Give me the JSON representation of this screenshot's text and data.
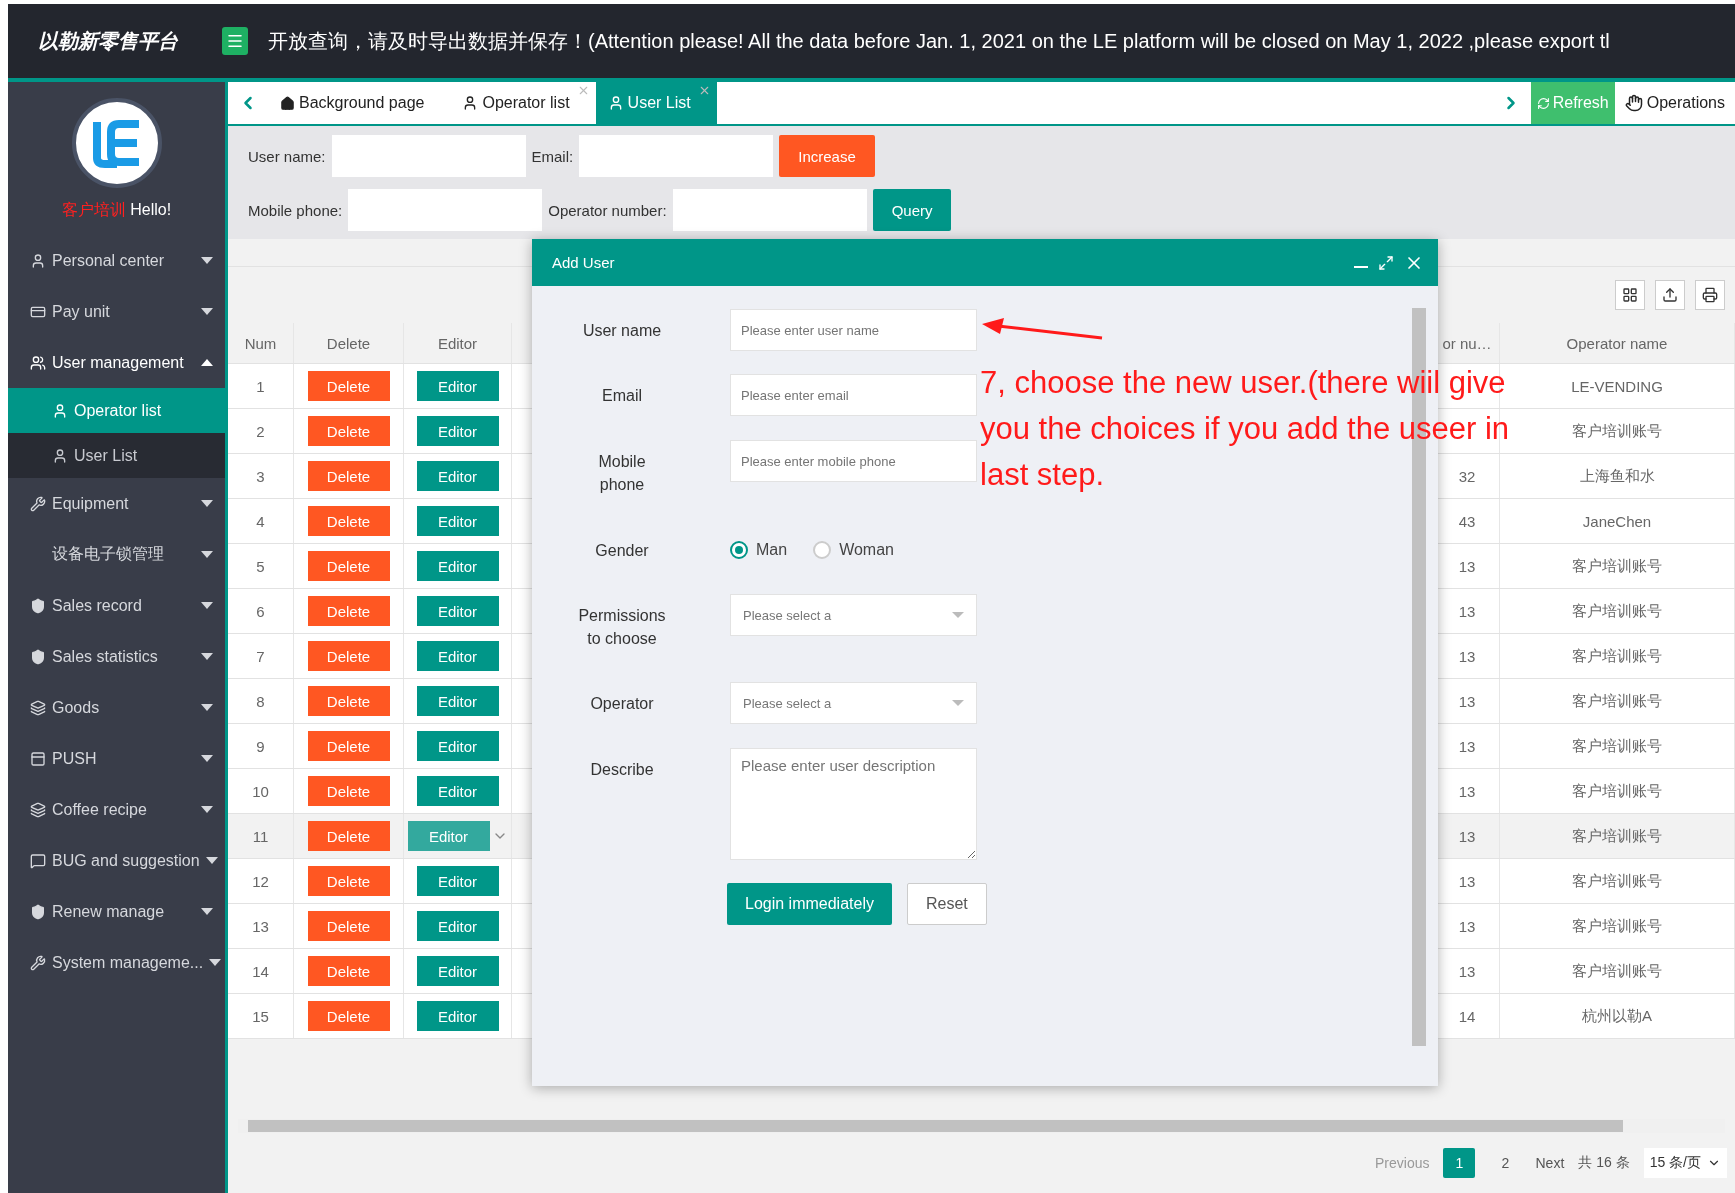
{
  "header": {
    "logo_text": "以勒新零售平台",
    "notice": "开放查询，请及时导出数据并保存！(Attention please! All the data before Jan. 1, 2021 on the LE platform will be closed on May 1, 2022 ,please export tl"
  },
  "sidebar": {
    "user_name": "客户培训",
    "greeting": "Hello!",
    "items": [
      {
        "label": "Personal center",
        "expanded": false
      },
      {
        "label": "Pay unit",
        "expanded": false
      },
      {
        "label": "User management",
        "expanded": true,
        "children": [
          {
            "label": "Operator list",
            "selected": true
          },
          {
            "label": "User List",
            "selected": false
          }
        ]
      },
      {
        "label": "Equipment",
        "expanded": false
      },
      {
        "label": "设备电子锁管理",
        "expanded": false
      },
      {
        "label": "Sales record",
        "expanded": false
      },
      {
        "label": "Sales statistics",
        "expanded": false
      },
      {
        "label": "Goods",
        "expanded": false
      },
      {
        "label": "PUSH",
        "expanded": false
      },
      {
        "label": "Coffee recipe",
        "expanded": false
      },
      {
        "label": "BUG and suggestion",
        "expanded": false
      },
      {
        "label": "Renew manage",
        "expanded": false
      },
      {
        "label": "System manageme...",
        "expanded": false
      }
    ]
  },
  "tabs": [
    {
      "label": "Background page",
      "selected": false,
      "closable": false
    },
    {
      "label": "Operator list",
      "selected": false,
      "closable": true
    },
    {
      "label": "User List",
      "selected": true,
      "closable": true
    }
  ],
  "tab_actions": {
    "refresh": "Refresh",
    "operations": "Operations"
  },
  "search": {
    "rows": [
      {
        "fields": [
          {
            "label": "User name:"
          },
          {
            "label": "Email:"
          }
        ],
        "button": {
          "label": "Increase",
          "kind": "warn"
        }
      },
      {
        "fields": [
          {
            "label": "Mobile phone:"
          },
          {
            "label": "Operator number:"
          }
        ],
        "button": {
          "label": "Query",
          "kind": "primary"
        }
      }
    ]
  },
  "table": {
    "columns": [
      "Num",
      "Delete",
      "Editor",
      "or nu…",
      "Operator name"
    ],
    "rows": [
      {
        "num": "1",
        "delete": "Delete",
        "editor": "Editor",
        "operator_name": "LE-VENDING",
        "hovered": false
      },
      {
        "num": "2",
        "delete": "Delete",
        "editor": "Editor",
        "operator_name": "客户培训账号",
        "hovered": false
      },
      {
        "num": "3",
        "delete": "Delete",
        "editor": "Editor",
        "operator_number": "32",
        "operator_name": "上海鱼和水",
        "hovered": false
      },
      {
        "num": "4",
        "delete": "Delete",
        "editor": "Editor",
        "operator_number": "43",
        "operator_name": "JaneChen",
        "hovered": false
      },
      {
        "num": "5",
        "delete": "Delete",
        "editor": "Editor",
        "operator_number": "13",
        "operator_name": "客户培训账号",
        "hovered": false
      },
      {
        "num": "6",
        "delete": "Delete",
        "editor": "Editor",
        "operator_number": "13",
        "operator_name": "客户培训账号",
        "hovered": false
      },
      {
        "num": "7",
        "delete": "Delete",
        "editor": "Editor",
        "operator_number": "13",
        "operator_name": "客户培训账号",
        "hovered": false
      },
      {
        "num": "8",
        "delete": "Delete",
        "editor": "Editor",
        "operator_number": "13",
        "operator_name": "客户培训账号",
        "hovered": false
      },
      {
        "num": "9",
        "delete": "Delete",
        "editor": "Editor",
        "operator_number": "13",
        "operator_name": "客户培训账号",
        "hovered": false
      },
      {
        "num": "10",
        "delete": "Delete",
        "editor": "Editor",
        "operator_number": "13",
        "operator_name": "客户培训账号",
        "hovered": false
      },
      {
        "num": "11",
        "delete": "Delete",
        "editor": "Editor",
        "operator_number": "13",
        "operator_name": "客户培训账号",
        "hovered": true
      },
      {
        "num": "12",
        "delete": "Delete",
        "editor": "Editor",
        "operator_number": "13",
        "operator_name": "客户培训账号",
        "hovered": false
      },
      {
        "num": "13",
        "delete": "Delete",
        "editor": "Editor",
        "operator_number": "13",
        "operator_name": "客户培训账号",
        "hovered": false
      },
      {
        "num": "14",
        "delete": "Delete",
        "editor": "Editor",
        "operator_number": "13",
        "operator_name": "客户培训账号",
        "hovered": false
      },
      {
        "num": "15",
        "delete": "Delete",
        "editor": "Editor",
        "operator_number": "14",
        "operator_name": "杭州以勒A",
        "hovered": false
      }
    ]
  },
  "pagination": {
    "previous": "Previous",
    "pages": [
      {
        "label": "1",
        "selected": true
      },
      {
        "label": "2",
        "selected": false
      }
    ],
    "next": "Next",
    "total": "共 16 条",
    "page_size": "15 条/页"
  },
  "dialog": {
    "title": "Add User",
    "fields": [
      {
        "kind": "text",
        "label": "User name",
        "placeholder": "Please enter user name"
      },
      {
        "kind": "text",
        "label": "Email",
        "placeholder": "Please enter email"
      },
      {
        "kind": "text",
        "label": "Mobile phone",
        "placeholder": "Please enter mobile phone"
      },
      {
        "kind": "radio",
        "label": "Gender",
        "options": [
          {
            "label": "Man",
            "selected": true
          },
          {
            "label": "Woman",
            "selected": false
          }
        ]
      },
      {
        "kind": "select",
        "label": "Permissions to choose",
        "placeholder": "Please select a"
      },
      {
        "kind": "select",
        "label": "Operator",
        "placeholder": "Please select a"
      },
      {
        "kind": "textarea",
        "label": "Describe",
        "placeholder": "Please enter user description"
      }
    ],
    "buttons": [
      {
        "label": "Login immediately",
        "kind": "primary"
      },
      {
        "label": "Reset",
        "kind": "plain"
      }
    ]
  },
  "annotation": {
    "lines": [
      "7, choose the new user.(there wiil give",
      "you the choices if you add the useer in",
      "last step."
    ]
  }
}
